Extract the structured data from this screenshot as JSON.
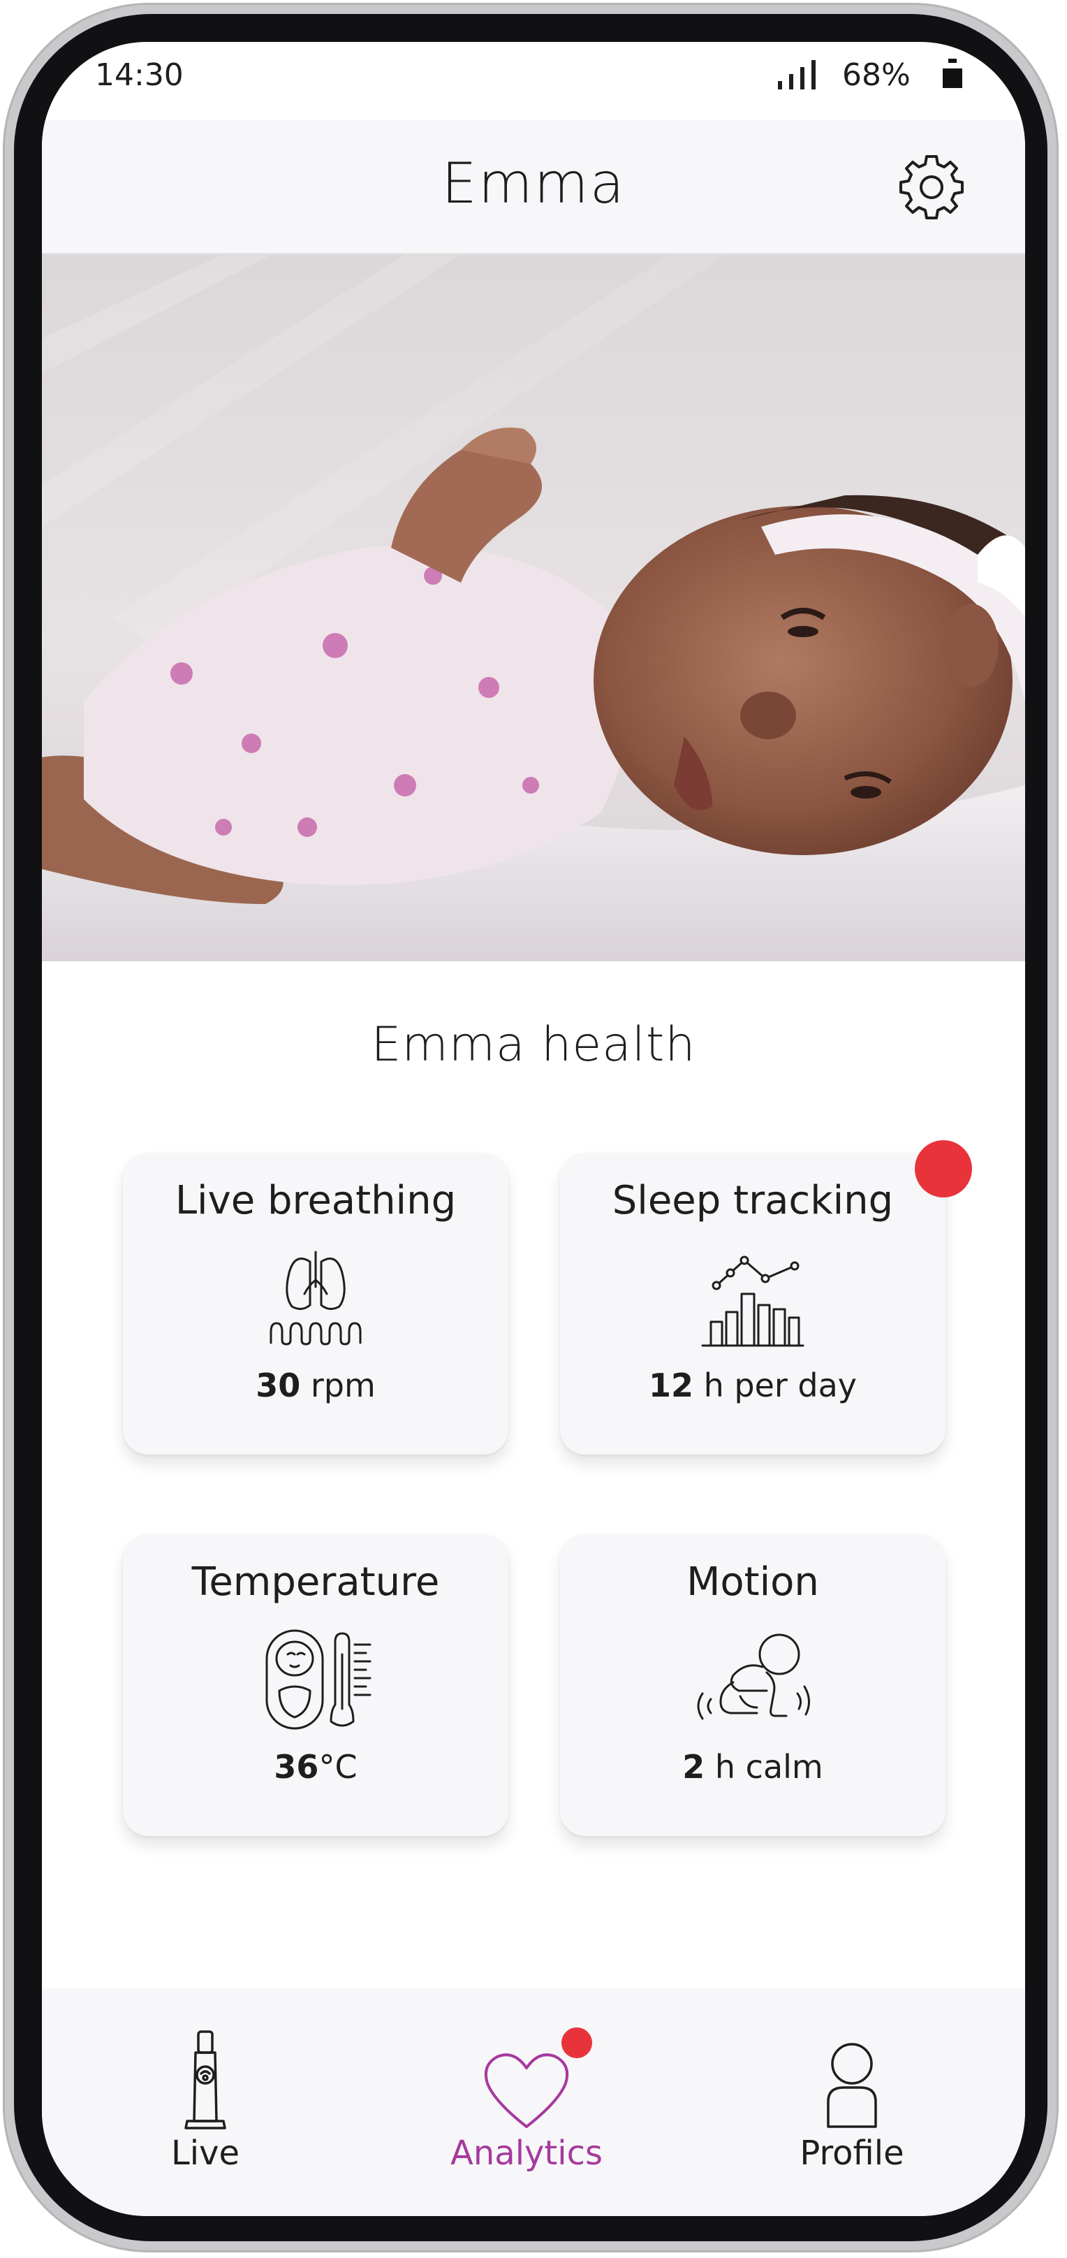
{
  "status_bar": {
    "time": "14:30",
    "battery": "68%"
  },
  "header": {
    "title": "Emma"
  },
  "section": {
    "title": "Emma health"
  },
  "cards": [
    {
      "title": "Live breathing",
      "value": "30",
      "unit": " rpm",
      "icon": "lungs-icon",
      "has_notification": false
    },
    {
      "title": "Sleep tracking",
      "value": "12",
      "unit": " h per day",
      "icon": "sleep-chart-icon",
      "has_notification": true
    },
    {
      "title": "Temperature",
      "value": "36",
      "unit": "°C",
      "icon": "thermometer-baby-icon",
      "has_notification": false
    },
    {
      "title": "Motion",
      "value": "2",
      "unit": " h calm",
      "icon": "crawling-baby-icon",
      "has_notification": false
    }
  ],
  "nav": {
    "items": [
      {
        "label": "Live",
        "icon": "baby-monitor-icon",
        "active": false
      },
      {
        "label": "Analytics",
        "icon": "heart-icon",
        "active": true
      },
      {
        "label": "Profile",
        "icon": "person-icon",
        "active": false
      }
    ]
  },
  "colors": {
    "accent": "#a63a9c",
    "notification": "#e8333b",
    "surface": "#f7f7fa",
    "text": "#1e1e1e"
  }
}
